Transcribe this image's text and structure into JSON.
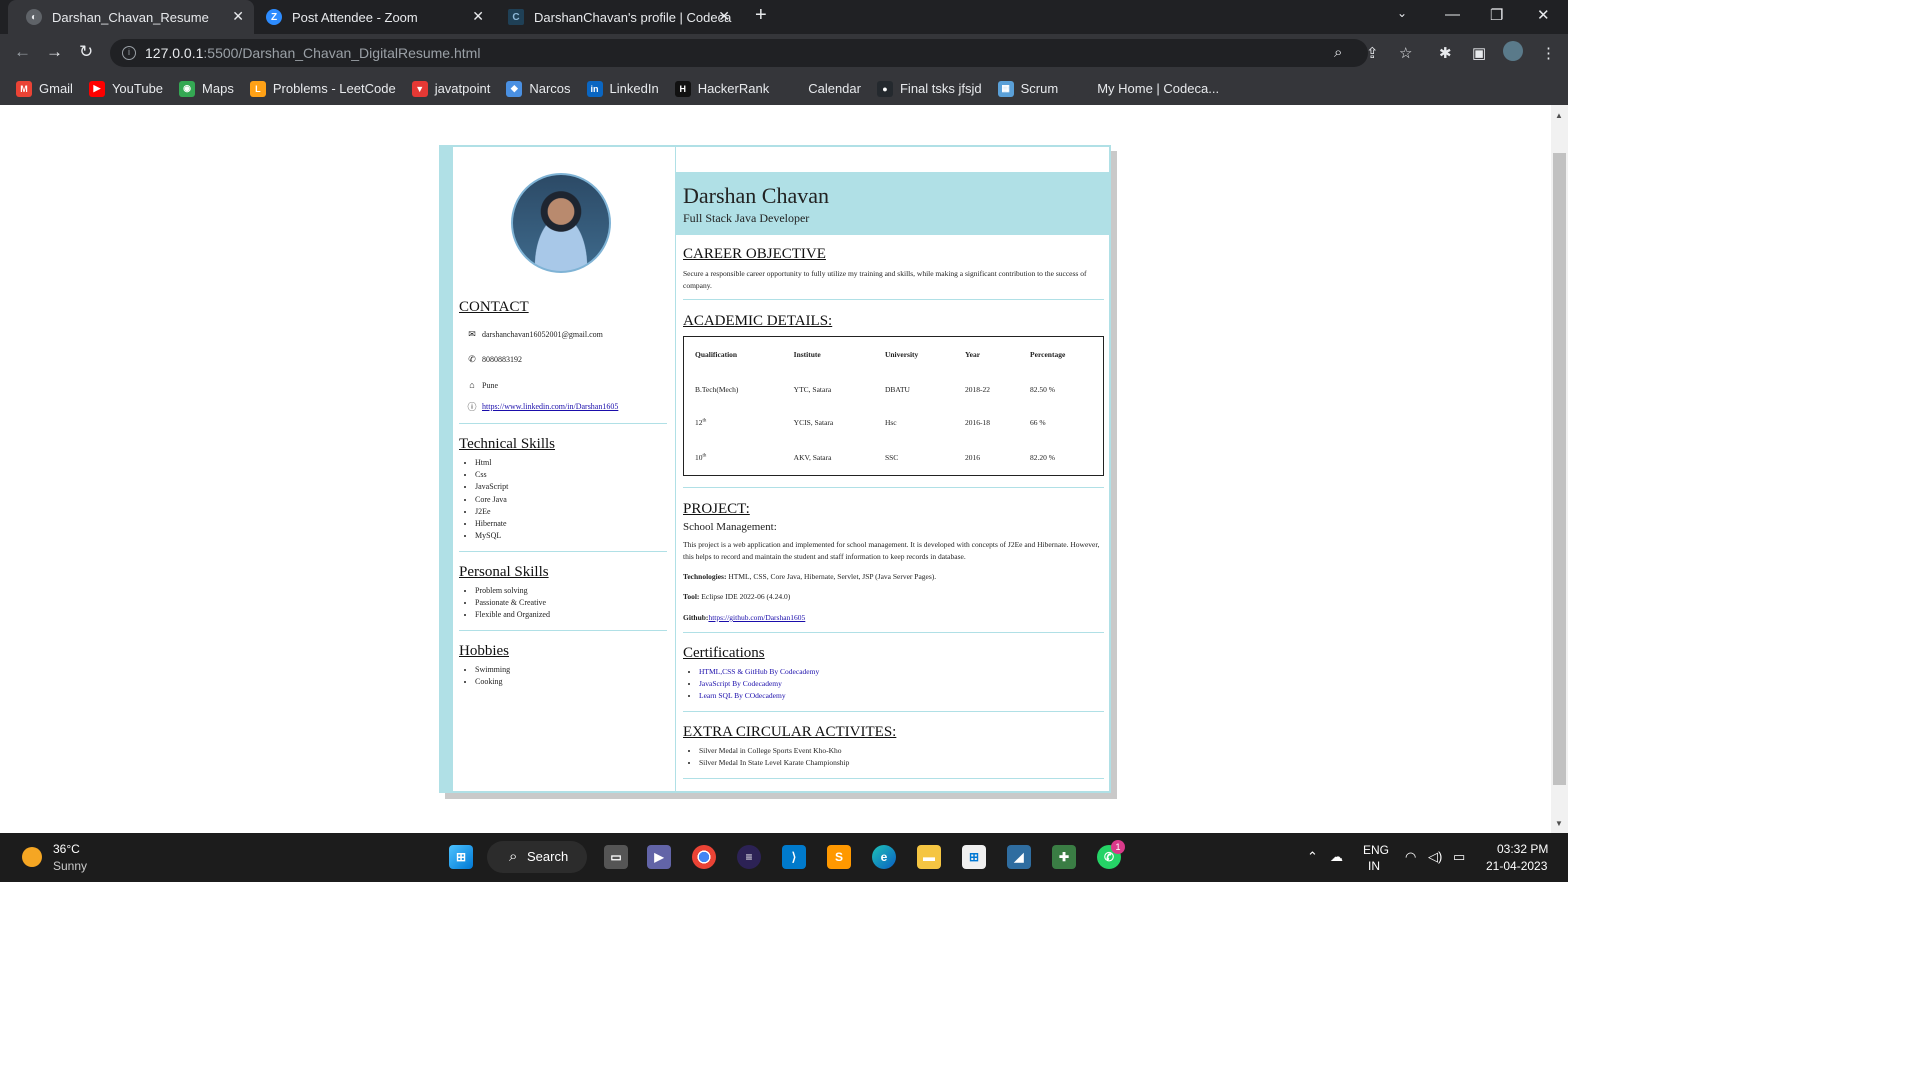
{
  "tabs": [
    {
      "title": "Darshan_Chavan_Resume",
      "icon": "globe-icon"
    },
    {
      "title": "Post Attendee - Zoom",
      "icon": "zoom-icon"
    },
    {
      "title": "DarshanChavan's profile | Codeca",
      "icon": "codecademy-icon"
    }
  ],
  "url": {
    "host": "127.0.0.1",
    "path": ":5500/Darshan_Chavan_DigitalResume.html"
  },
  "bookmarks": [
    {
      "label": "Gmail",
      "color": "#ea4335",
      "glyph": "M"
    },
    {
      "label": "YouTube",
      "color": "#ff0000",
      "glyph": "▶"
    },
    {
      "label": "Maps",
      "color": "#34a853",
      "glyph": "◉"
    },
    {
      "label": "Problems - LeetCode",
      "color": "#ffa116",
      "glyph": "L"
    },
    {
      "label": "javatpoint",
      "color": "#e53935",
      "glyph": "▼"
    },
    {
      "label": "Narcos",
      "color": "#4a90e2",
      "glyph": "◆"
    },
    {
      "label": "LinkedIn",
      "color": "#0a66c2",
      "glyph": "in"
    },
    {
      "label": "HackerRank",
      "color": "#111111",
      "glyph": "H"
    },
    {
      "label": "Calendar",
      "color": "#35363a",
      "glyph": ""
    },
    {
      "label": "Final tsks jfsjd",
      "color": "#24292e",
      "glyph": "●"
    },
    {
      "label": "Scrum",
      "color": "#5aa0d8",
      "glyph": "▦"
    },
    {
      "label": "My Home | Codeca...",
      "color": "#35363a",
      "glyph": ""
    }
  ],
  "resume": {
    "name": "Darshan Chavan",
    "role": "Full Stack Java Developer",
    "contact_title": "CONTACT",
    "contact": {
      "email": "darshanchavan16052001@gmail.com",
      "phone": "8080883192",
      "location": "Pune",
      "linkedin": "https://www.linkedin.com/in/Darshan1605"
    },
    "technical_title": "Technical Skills",
    "technical": [
      "Html",
      "Css",
      "JavaScript",
      "Core Java",
      "J2Ee",
      "Hibernate",
      "MySQL"
    ],
    "personal_title": "Personal Skills",
    "personal": [
      "Problem solving",
      "Passionate & Creative",
      "Flexible and Organized"
    ],
    "hobbies_title": "Hobbies",
    "hobbies": [
      "Swimming",
      "Cooking"
    ],
    "career_title": "CAREER OBJECTIVE",
    "career": "Secure a responsible career opportunity to fully utilize my training and skills, while making a significant contribution to the success of company.",
    "academic_title": "ACADEMIC DETAILS:",
    "academic_headers": [
      "Qualification",
      "Institute",
      "University",
      "Year",
      "Percentage"
    ],
    "academic_rows": [
      [
        "B.Tech(Mech)",
        "YTC, Satara",
        "DBATU",
        "2018-22",
        "82.50 %"
      ],
      [
        "12",
        "YCIS, Satara",
        "Hsc",
        "2016-18",
        "66 %"
      ],
      [
        "10",
        "AKV, Satara",
        "SSC",
        "2016",
        "82.20 %"
      ]
    ],
    "ordinal_sup": "th",
    "project_title": "PROJECT:",
    "project_name": "School Management:",
    "project_desc": "This project is a web application and implemented for school management. It is developed with concepts of J2Ee and Hibernate. However, this helps to record and maintain the student and staff information to keep records in database.",
    "tech_label": "Technologies:",
    "tech_value": " HTML, CSS, Core Java, Hibernate, Servlet, JSP (Java Server Pages).",
    "tool_label": "Tool:",
    "tool_value": " Eclipse IDE 2022-06 (4.24.0)",
    "github_label": "Github:",
    "github_value": "https://github.com/Darshan1605",
    "cert_title": "Certifications",
    "certs": [
      "HTML,CSS & GitHub By Codecademy",
      "JavaScript By Codecademy",
      "Learn SQL By COdecademy"
    ],
    "extra_title": "EXTRA CIRCULAR ACTIVITES:",
    "extras": [
      "Silver Medal in College Sports Event Kho-Kho",
      "Silver Medal In State Level Karate Championship"
    ]
  },
  "taskbar": {
    "temp": "36°C",
    "weather": "Sunny",
    "search": "Search",
    "lang1": "ENG",
    "lang2": "IN",
    "time": "03:32 PM",
    "date": "21-04-2023",
    "badge": "1"
  }
}
